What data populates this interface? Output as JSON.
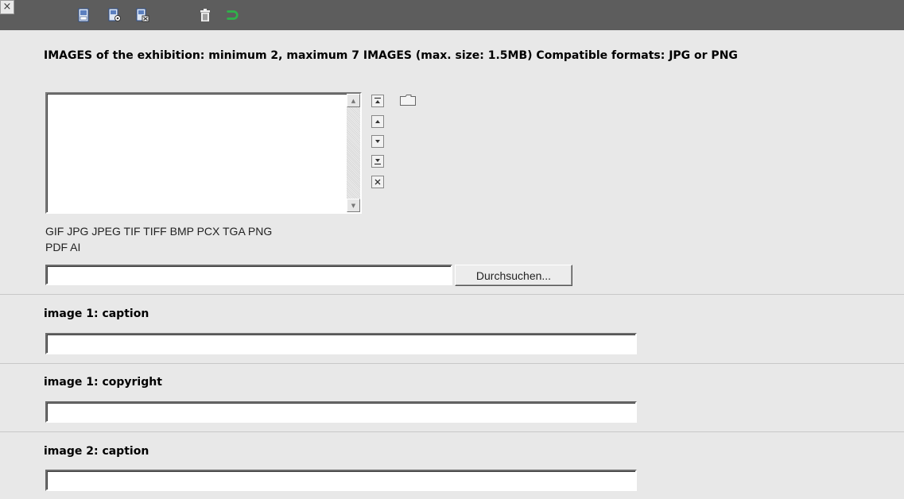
{
  "toolbar": {
    "close": "×",
    "icons": [
      "close-icon",
      "save-icon",
      "save-view-icon",
      "save-close-icon",
      "delete-icon",
      "undo-icon"
    ],
    "accent_undo": "#2fb34a"
  },
  "images_field": {
    "label": "IMAGES of the exhibition: minimum 2, maximum 7 IMAGES (max. size: 1.5MB) Compatible formats: JPG or PNG",
    "formats_line1": "GIF JPG JPEG TIF TIFF BMP PCX TGA PNG",
    "formats_line2": "PDF AI",
    "file_value": "",
    "browse_label": "Durchsuchen..."
  },
  "fields": [
    {
      "label": "image 1: caption",
      "value": ""
    },
    {
      "label": "image 1: copyright",
      "value": ""
    },
    {
      "label": "image 2: caption",
      "value": ""
    }
  ]
}
